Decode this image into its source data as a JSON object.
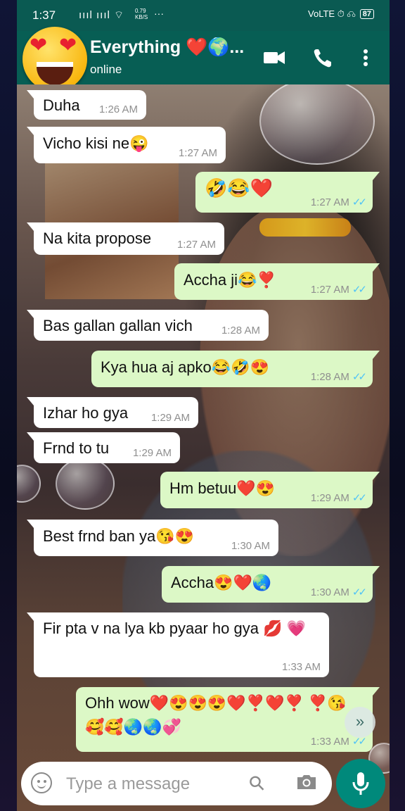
{
  "status_bar": {
    "time": "1:37",
    "signal": "ıııl ıııl ⌔",
    "speed": "0.79\nKB/S",
    "more": "···",
    "right_icons": "VoLTE ⏱ ☊",
    "battery": "87"
  },
  "header": {
    "contact_name": "Everything ❤️🌍...",
    "status": "online"
  },
  "messages": [
    {
      "text": "Duha",
      "time": "1:26 AM"
    },
    {
      "text": "Vicho kisi ne😜",
      "time": "1:27 AM"
    },
    {
      "text": "🤣😂❤️",
      "time": "1:27 AM"
    },
    {
      "text": "Na kita propose",
      "time": "1:27 AM"
    },
    {
      "text": "Accha ji😂❣️",
      "time": "1:27 AM"
    },
    {
      "text": "Bas gallan gallan vich",
      "time": "1:28 AM"
    },
    {
      "text": "Kya hua aj apko😂🤣😍",
      "time": "1:28 AM"
    },
    {
      "text": "Izhar ho gya",
      "time": "1:29 AM"
    },
    {
      "text": "Frnd to tu",
      "time": "1:29 AM"
    },
    {
      "text": "Hm betuu❤️😍",
      "time": "1:29 AM"
    },
    {
      "text": "Best frnd ban ya😘😍",
      "time": "1:30 AM"
    },
    {
      "text": "Accha😍❤️🌏",
      "time": "1:30 AM"
    },
    {
      "text": "Fir pta v na lya kb pyaar ho gya 💋 💗",
      "time": "1:33 AM"
    },
    {
      "text": "Ohh wow❤️😍😍😍❤️❣️❤️❣️ ❣️😘🥰🥰🌏🌏💞",
      "time": "1:33 AM"
    }
  ],
  "tick": "✓✓",
  "composer": {
    "placeholder": "Type a message"
  },
  "icons": {
    "video": "video-call-icon",
    "phone": "voice-call-icon",
    "menu": "more-vert-icon",
    "emoji": "emoji-icon",
    "attach": "attach-icon",
    "camera": "camera-icon",
    "mic": "mic-icon",
    "scroll": "chevron-double-down-icon"
  },
  "colors": {
    "header": "#075e54",
    "outgoing_bubble": "#dcf8c6",
    "incoming_bubble": "#ffffff",
    "read_tick": "#4fc3f7",
    "mic_button": "#00897b"
  }
}
